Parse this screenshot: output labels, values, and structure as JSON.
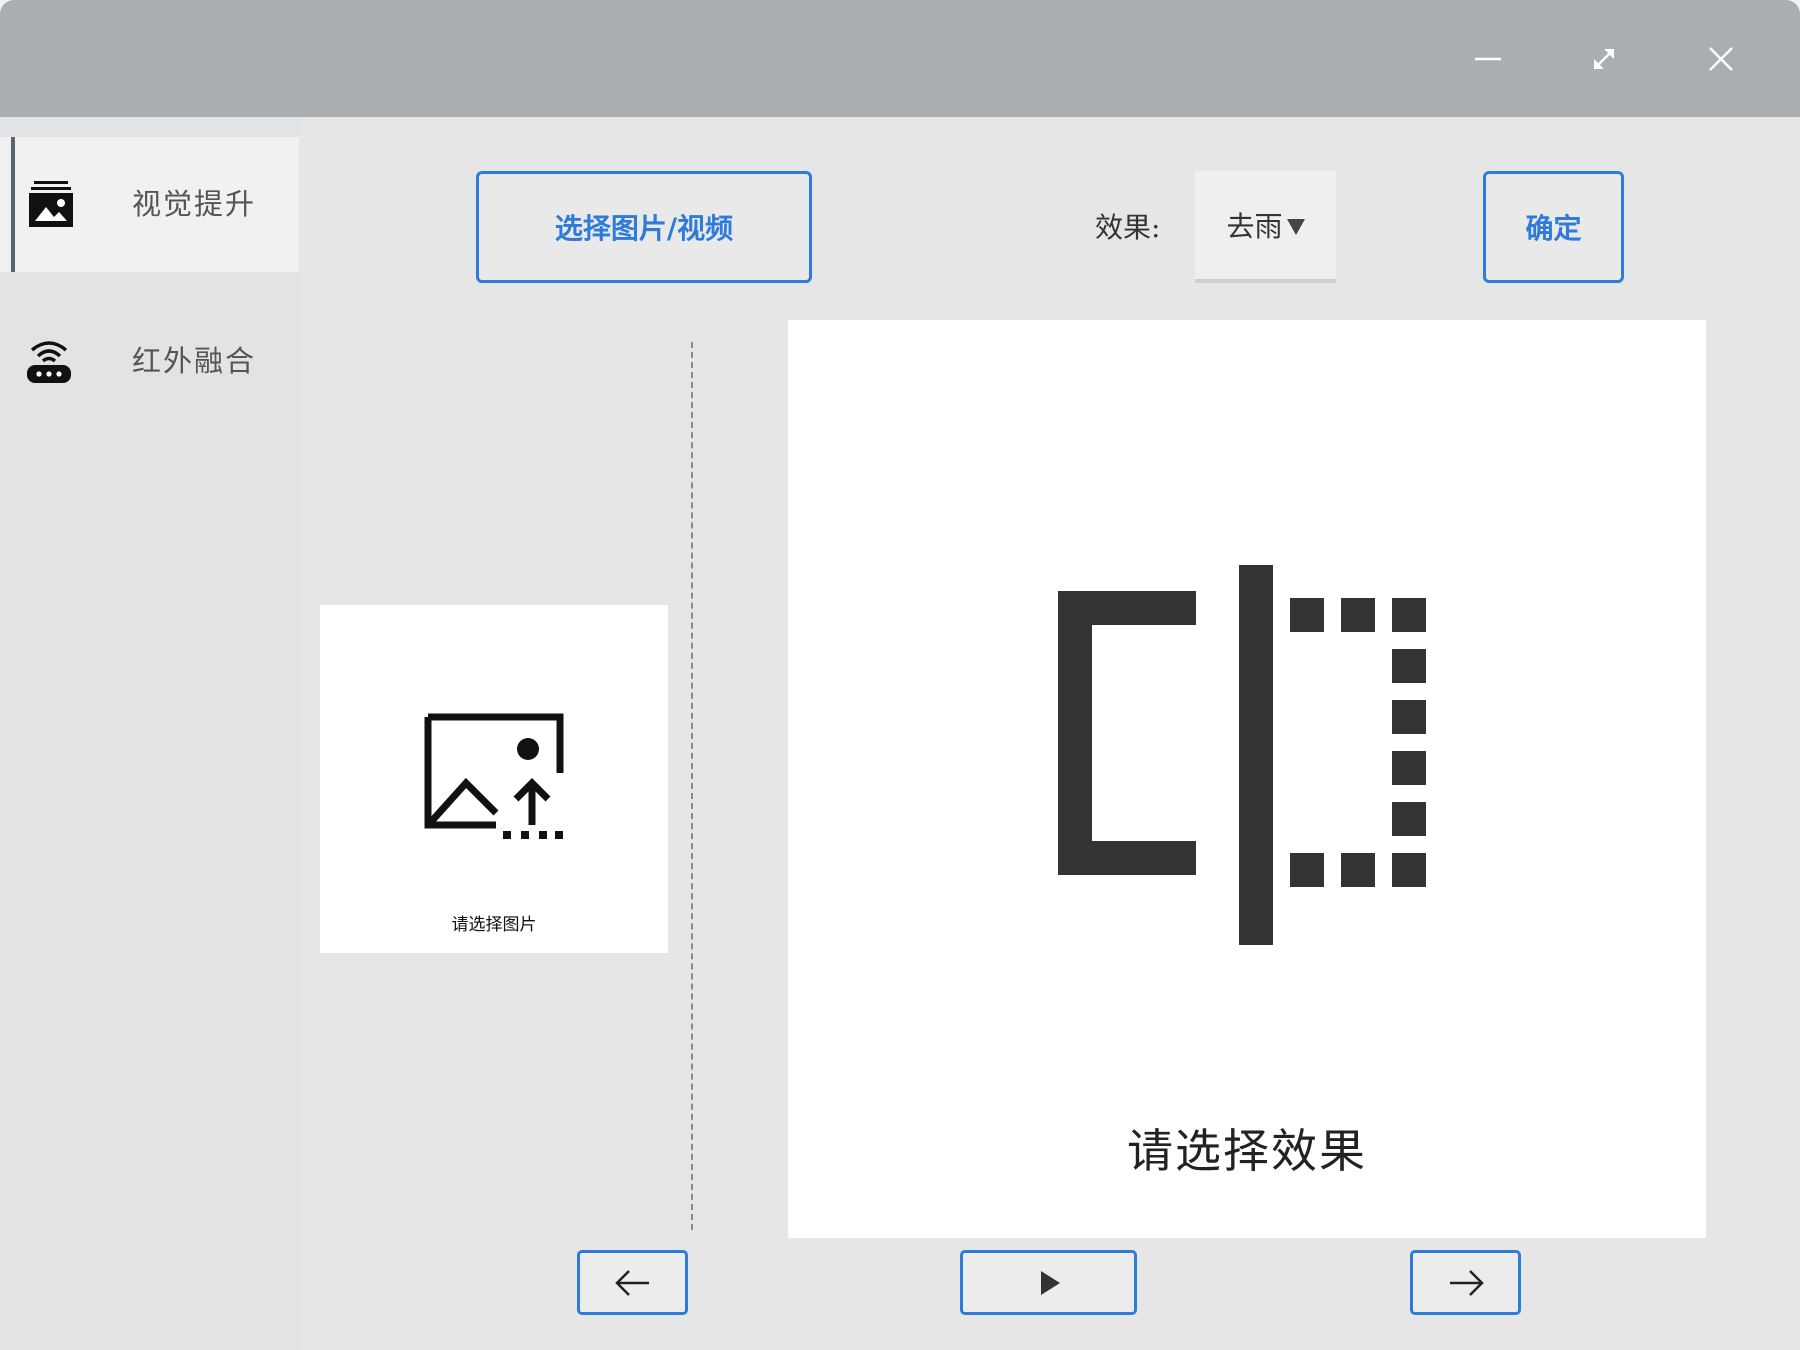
{
  "window": {
    "controls": {
      "minimize_icon": "minimize-icon",
      "maximize_icon": "maximize-icon",
      "close_icon": "close-icon"
    }
  },
  "sidebar": {
    "items": [
      {
        "label": "视觉提升",
        "icon": "image-icon",
        "active": true
      },
      {
        "label": "红外融合",
        "icon": "wifi-router-icon",
        "active": false
      }
    ]
  },
  "toolbar": {
    "select_media_label": "选择图片/视频",
    "effect_label": "效果:",
    "effect_value": "去雨",
    "confirm_label": "确定"
  },
  "source_panel": {
    "caption": "请选择图片",
    "icon": "image-upload-icon"
  },
  "preview_panel": {
    "caption": "请选择效果",
    "icon": "compare-icon"
  },
  "playback": {
    "prev_icon": "arrow-left-icon",
    "play_icon": "play-icon",
    "next_icon": "arrow-right-icon"
  },
  "colors": {
    "accent": "#2f7bd9",
    "titlebar": "#a9aeb2",
    "sidebar": "#e2e3e5",
    "background": "#e6e6e6"
  }
}
